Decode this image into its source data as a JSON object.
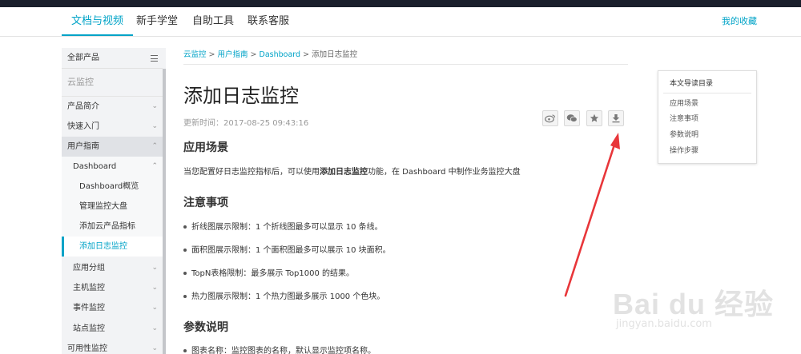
{
  "topnav": {
    "items": [
      "文档与视频",
      "新手学堂",
      "自助工具",
      "联系客服"
    ],
    "right": "我的收藏"
  },
  "sidebar": {
    "all_products": "全部产品",
    "product": "云监控",
    "items": [
      {
        "label": "产品简介"
      },
      {
        "label": "快速入门"
      },
      {
        "label": "用户指南"
      },
      {
        "label": "Dashboard"
      },
      {
        "label": "Dashboard概览"
      },
      {
        "label": "管理监控大盘"
      },
      {
        "label": "添加云产品指标"
      },
      {
        "label": "添加日志监控"
      },
      {
        "label": "应用分组"
      },
      {
        "label": "主机监控"
      },
      {
        "label": "事件监控"
      },
      {
        "label": "站点监控"
      },
      {
        "label": "可用性监控"
      }
    ]
  },
  "breadcrumb": {
    "links": [
      "云监控",
      "用户指南",
      "Dashboard"
    ],
    "sep": " > ",
    "current": "添加日志监控"
  },
  "article": {
    "title": "添加日志监控",
    "updated": "更新时间：2017-08-25 09:43:16",
    "section1": "应用场景",
    "para_pre": "当您配置好日志监控指标后，可以使用",
    "para_bold": "添加日志监控",
    "para_post": "功能，在 Dashboard 中制作业务监控大盘",
    "section2": "注意事项",
    "bullets": [
      "折线图展示限制：1 个折线图最多可以显示 10 条线。",
      "面积图展示限制：1 个面积图最多可以展示 10 块面积。",
      "TopN表格限制：最多展示 Top1000 的结果。",
      "热力图展示限制：1 个热力图最多展示 1000 个色块。"
    ],
    "section3": "参数说明",
    "param_bullet": "图表名称：监控图表的名称，默认显示监控项名称。"
  },
  "toc": {
    "title": "本文导读目录",
    "items": [
      "应用场景",
      "注意事项",
      "参数说明",
      "操作步骤"
    ]
  },
  "share_icons": [
    "weibo-icon",
    "wechat-icon",
    "star-icon",
    "download-icon"
  ],
  "watermark": {
    "big": "Bai  du 经验",
    "small": "jingyan.baidu.com"
  },
  "colors": {
    "accent": "#00a3c7",
    "arrow": "#e8363a",
    "topstrip": "#1a1f2c"
  }
}
